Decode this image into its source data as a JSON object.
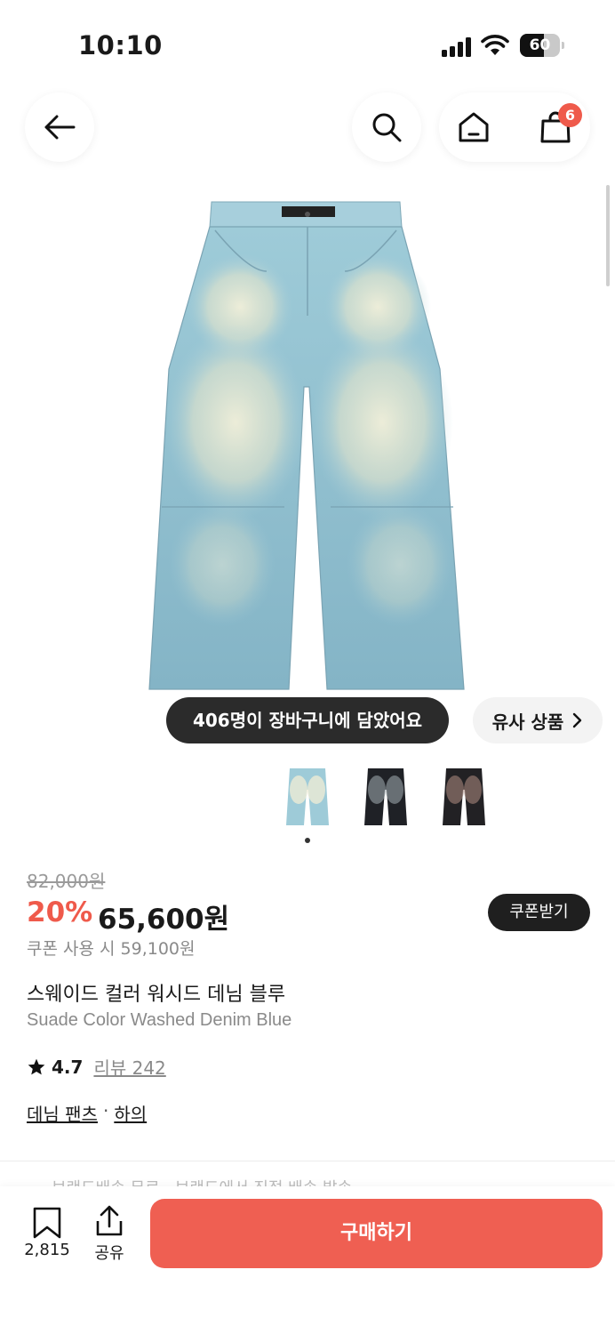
{
  "status_bar": {
    "time": "10:10",
    "battery_level": "60",
    "battery_percent": 0.6
  },
  "nav": {
    "back_icon": "arrow-left-icon",
    "search_icon": "search-icon",
    "home_icon": "home-icon",
    "cart_icon": "shopping-bag-icon",
    "cart_badge": "6"
  },
  "product": {
    "cart_count_text": "406명이 장바구니에 담았어요",
    "similar_label": "유사 상품",
    "original_price": "82,000원",
    "discount_rate": "20%",
    "sale_price": "65,600원",
    "coupon_button": "쿠폰받기",
    "coupon_price": "쿠폰 사용 시 59,100원",
    "name_kr": "스웨이드 컬러 워시드 데님 블루",
    "name_en": "Suade Color Washed Denim Blue",
    "rating": "4.7",
    "review_label": "리뷰 242",
    "category_1": "데님 팬츠",
    "category_sep": "·",
    "category_2": "하의",
    "peek_text": "브랜드배송 무료 · 브랜드에서 직접 배송 발송",
    "thumbnails": [
      {
        "name": "blue-washed"
      },
      {
        "name": "black-washed"
      },
      {
        "name": "brown-washed"
      }
    ]
  },
  "bottom_bar": {
    "wishlist_count": "2,815",
    "share_label": "공유",
    "buy_label": "구매하기"
  },
  "colors": {
    "accent": "#ef5a4b",
    "buy_button": "#ef5f52",
    "dark_pill": "#2b2b2b"
  }
}
